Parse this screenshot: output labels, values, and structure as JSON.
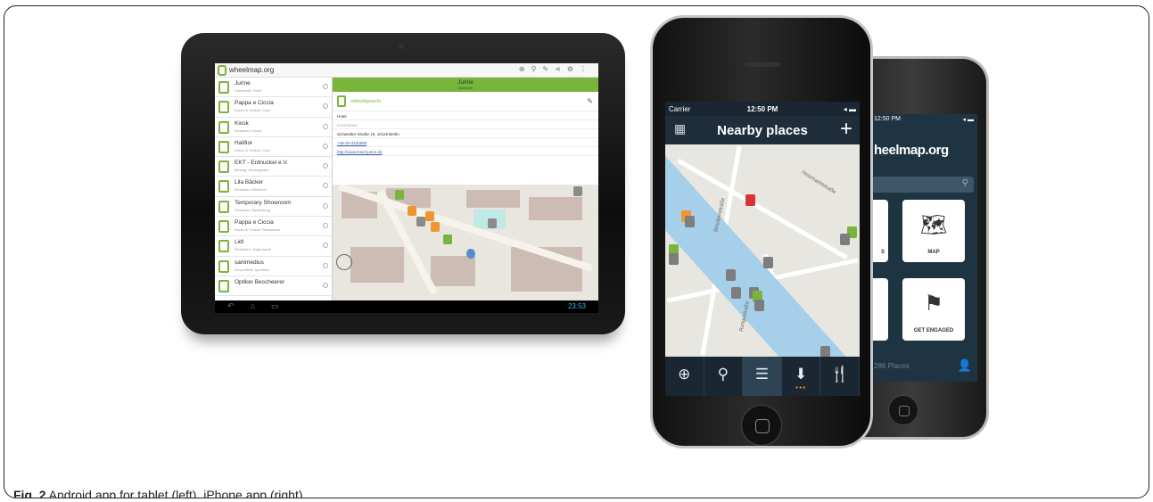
{
  "caption": {
    "label": "Fig. 2",
    "text": " Android app for tablet (left), iPhone app (right)"
  },
  "tablet": {
    "app_title": "wheelmap.org",
    "list": [
      {
        "name": "Jurine",
        "sub": "Unterkunft: Hotel"
      },
      {
        "name": "Pappa e Ciccia",
        "sub": "Essen & Trinken: Cafe"
      },
      {
        "name": "Kiosk",
        "sub": "Einkaufen: Kiosk"
      },
      {
        "name": "Halifior",
        "sub": "Essen & Trinken: Cafe"
      },
      {
        "name": "EKT - Erdnuckel e.V.",
        "sub": "Bildung: Kindergarten"
      },
      {
        "name": "Lila Bäcker",
        "sub": "Einkaufen: Bäckerei"
      },
      {
        "name": "Temporary Showroom",
        "sub": "Einkaufen: Bekleidung"
      },
      {
        "name": "Pappa e Ciccia",
        "sub": "Essen & Trinken: Restaurant"
      },
      {
        "name": "Lidl",
        "sub": "Einkaufen: Supermarkt"
      },
      {
        "name": "sanimedius",
        "sub": "Gesundheit: Apotheke"
      },
      {
        "name": "Optiker Bescheerer",
        "sub": ""
      }
    ],
    "detail": {
      "title": "Jurine",
      "subtitle": "Unterkunft",
      "status": "rollstuhlgerecht",
      "category": "Hotel",
      "comment_hint": "Kommentar",
      "address": "Schwedter Straße 15, 10119 Berlin",
      "phone": "+49-30-4432990",
      "website": "http://www.hotel-jurine.de"
    },
    "clock": "23:53"
  },
  "iphone_back": {
    "status_time": "12:50 PM",
    "logo": "heelmap.org",
    "tiles": [
      {
        "label": "MAP",
        "icon": "map-icon"
      },
      {
        "label": "GET ENGAGED",
        "icon": "flag-icon"
      }
    ],
    "places": "286 Places"
  },
  "iphone_front": {
    "carrier": "Carrier",
    "time": "12:50 PM",
    "nav_title": "Nearby places",
    "tabs": [
      {
        "icon": "locate-icon",
        "glyph": "⊕"
      },
      {
        "icon": "search-icon",
        "glyph": "⚲"
      },
      {
        "icon": "list-icon",
        "glyph": "☰"
      },
      {
        "icon": "wheelchair-filter-icon",
        "glyph": "⬇"
      },
      {
        "icon": "category-food-icon",
        "glyph": "🍴"
      }
    ],
    "streets": [
      "Holzmarktstraße",
      "Brückenstraße",
      "Rungestraße"
    ]
  },
  "colors": {
    "accent_green": "#79b43b",
    "iphone_navy": "#1f2e3b",
    "river_blue": "#a6cfe9"
  }
}
